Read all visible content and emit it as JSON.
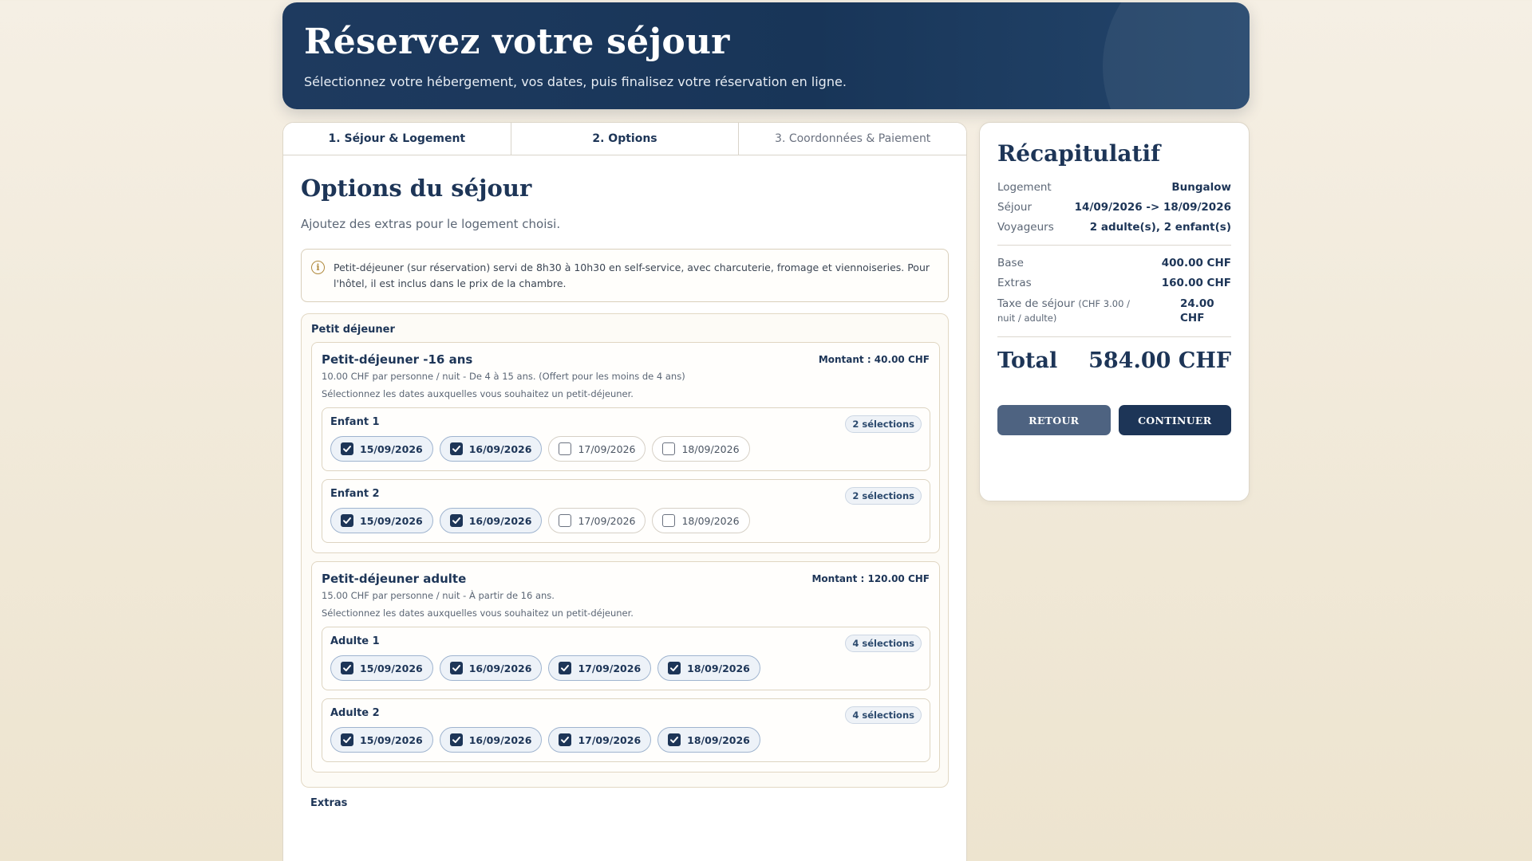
{
  "header": {
    "title": "Réservez votre séjour",
    "subtitle": "Sélectionnez votre hébergement, vos dates, puis finalisez votre réservation en ligne."
  },
  "tabs": [
    {
      "label": "1. Séjour & Logement"
    },
    {
      "label": "2. Options"
    },
    {
      "label": "3. Coordonnées & Paiement"
    }
  ],
  "main": {
    "title": "Options du séjour",
    "subtitle": "Ajoutez des extras pour le logement choisi.",
    "info": "Petit-déjeuner (sur réservation) servi de 8h30 à 10h30 en self-service, avec charcuterie, fromage et viennoiseries. Pour l'hôtel, il est inclus dans le prix de la chambre.",
    "section_title": "Petit déjeuner",
    "extras_title": "Extras",
    "products": [
      {
        "name": "Petit-déjeuner -16 ans",
        "amount": "Montant : 40.00 CHF",
        "desc": "10.00 CHF par personne / nuit - De 4 à 15 ans. (Offert pour les moins de 4 ans)",
        "hint": "Sélectionnez les dates auxquelles vous souhaitez un petit-déjeuner.",
        "persons": [
          {
            "name": "Enfant 1",
            "badge": "2 sélections",
            "dates": [
              {
                "label": "15/09/2026",
                "checked": true
              },
              {
                "label": "16/09/2026",
                "checked": true
              },
              {
                "label": "17/09/2026",
                "checked": false
              },
              {
                "label": "18/09/2026",
                "checked": false
              }
            ]
          },
          {
            "name": "Enfant 2",
            "badge": "2 sélections",
            "dates": [
              {
                "label": "15/09/2026",
                "checked": true
              },
              {
                "label": "16/09/2026",
                "checked": true
              },
              {
                "label": "17/09/2026",
                "checked": false
              },
              {
                "label": "18/09/2026",
                "checked": false
              }
            ]
          }
        ]
      },
      {
        "name": "Petit-déjeuner adulte",
        "amount": "Montant : 120.00 CHF",
        "desc": "15.00 CHF par personne / nuit - À partir de 16 ans.",
        "hint": "Sélectionnez les dates auxquelles vous souhaitez un petit-déjeuner.",
        "persons": [
          {
            "name": "Adulte 1",
            "badge": "4 sélections",
            "dates": [
              {
                "label": "15/09/2026",
                "checked": true
              },
              {
                "label": "16/09/2026",
                "checked": true
              },
              {
                "label": "17/09/2026",
                "checked": true
              },
              {
                "label": "18/09/2026",
                "checked": true
              }
            ]
          },
          {
            "name": "Adulte 2",
            "badge": "4 sélections",
            "dates": [
              {
                "label": "15/09/2026",
                "checked": true
              },
              {
                "label": "16/09/2026",
                "checked": true
              },
              {
                "label": "17/09/2026",
                "checked": true
              },
              {
                "label": "18/09/2026",
                "checked": true
              }
            ]
          }
        ]
      }
    ]
  },
  "summary": {
    "title": "Récapitulatif",
    "logement_k": "Logement",
    "logement_v": "Bungalow",
    "sejour_k": "Séjour",
    "sejour_v": "14/09/2026 -> 18/09/2026",
    "voyageurs_k": "Voyageurs",
    "voyageurs_v": "2 adulte(s), 2 enfant(s)",
    "base_k": "Base",
    "base_v": "400.00 CHF",
    "extras_k": "Extras",
    "extras_v": "160.00 CHF",
    "taxe_k": "Taxe de séjour",
    "taxe_note": "(CHF 3.00 / nuit / adulte)",
    "taxe_v": "24.00 CHF",
    "total_k": "Total",
    "total_v": "584.00 CHF",
    "back_label": "RETOUR",
    "next_label": "CONTINUER"
  }
}
